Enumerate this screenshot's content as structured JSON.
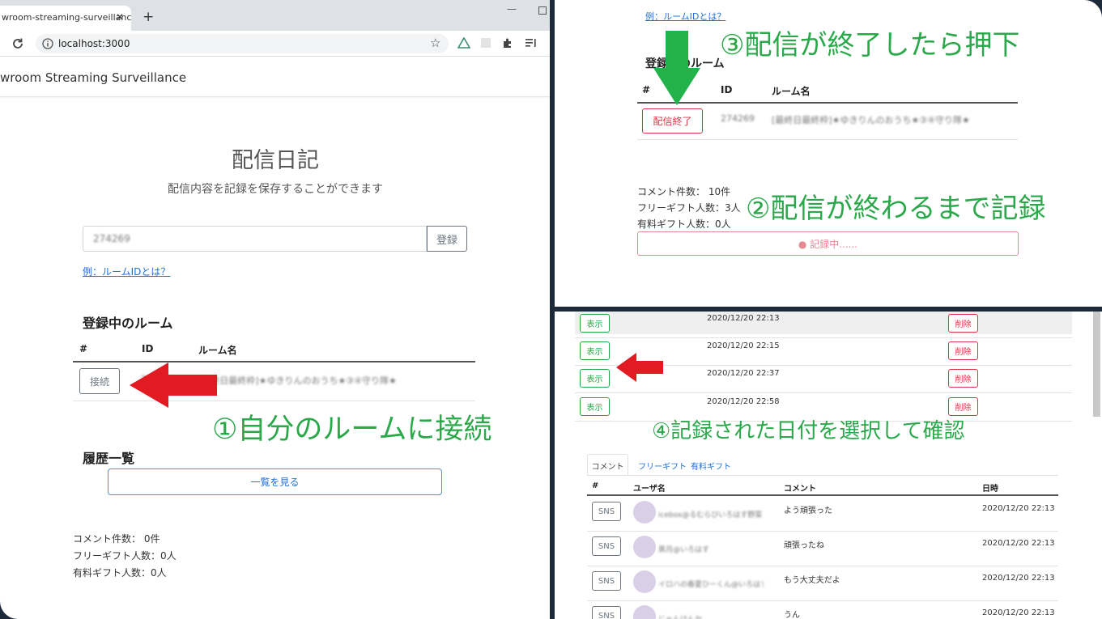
{
  "browser": {
    "tab_title": "wroom-streaming-surveillance",
    "tab_close": "✕",
    "new_tab": "+",
    "url": "localhost:3000",
    "minimize": "—"
  },
  "app": {
    "navbar_title": "wroom Streaming Surveillance",
    "heading": "配信日記",
    "subtitle": "配信内容を記録を保存することができます",
    "room_input_value": "274269",
    "register_button": "登録",
    "example_link": "例：ルームIDとは？",
    "registered_rooms_heading": "登録中のルーム",
    "table_headers": [
      "#",
      "ID",
      "ルーム名"
    ],
    "connect_button": "接続",
    "room_id": "274269",
    "room_name": "[最終日最終枠]★ゆきりんのおうち★③④守り隊★",
    "history_heading": "履歴一覧",
    "view_list_button": "一覧を見る",
    "stats": [
      "コメント件数： 0件",
      "フリーギフト人数：0人",
      "有料ギフト人数：0人"
    ]
  },
  "panel2": {
    "example_link": "例：ルームIDとは？",
    "registered_rooms_heading": "登録中のルーム",
    "table_headers": [
      "#",
      "ID",
      "ルーム名"
    ],
    "end_button": "配信終了",
    "room_id": "274269",
    "room_name": "[最終日最終枠]★ゆきりんのおうち★③④守り隊★",
    "stats": [
      "コメント件数： 10件",
      "フリーギフト人数：3人",
      "有料ギフト人数：0人"
    ],
    "recording_label": "● 記録中......"
  },
  "panel3": {
    "history_rows": [
      {
        "show": "表示",
        "date": "2020/12/20 22:13",
        "delete": "削除"
      },
      {
        "show": "表示",
        "date": "2020/12/20 22:15",
        "delete": "削除"
      },
      {
        "show": "表示",
        "date": "2020/12/20 22:37",
        "delete": "削除"
      },
      {
        "show": "表示",
        "date": "2020/12/20 22:58",
        "delete": "削除"
      }
    ],
    "tabs": [
      "コメント",
      "フリーギフト",
      "有料ギフト"
    ],
    "comment_headers": [
      "#",
      "ユーザ名",
      "コメント",
      "日時"
    ],
    "comments": [
      {
        "sns": "SNS",
        "user": "icebox@るむらびいろはす野菜",
        "comment": "よう頑張った",
        "date": "2020/12/20 22:13"
      },
      {
        "sns": "SNS",
        "user": "黒月@いろはす",
        "comment": "頑張ったね",
        "date": "2020/12/20 22:13"
      },
      {
        "sns": "SNS",
        "user": "イロハの春夏ひーくん@いろはす",
        "comment": "もう大丈夫だよ",
        "date": "2020/12/20 22:13"
      },
      {
        "sns": "SNS",
        "user": "じゃんけんか",
        "comment": "うん",
        "date": "2020/12/20 22:13"
      }
    ]
  },
  "annotations": {
    "step1": "①自分のルームに接続",
    "step2": "②配信が終わるまで記録",
    "step3": "③配信が終了したら押下",
    "step4": "④記録された日付を選択して確認"
  },
  "colors": {
    "annotation_green": "#2aa84a",
    "arrow_red": "#e21b23",
    "arrow_green": "#21b34a",
    "background": "#1c2a3a"
  }
}
